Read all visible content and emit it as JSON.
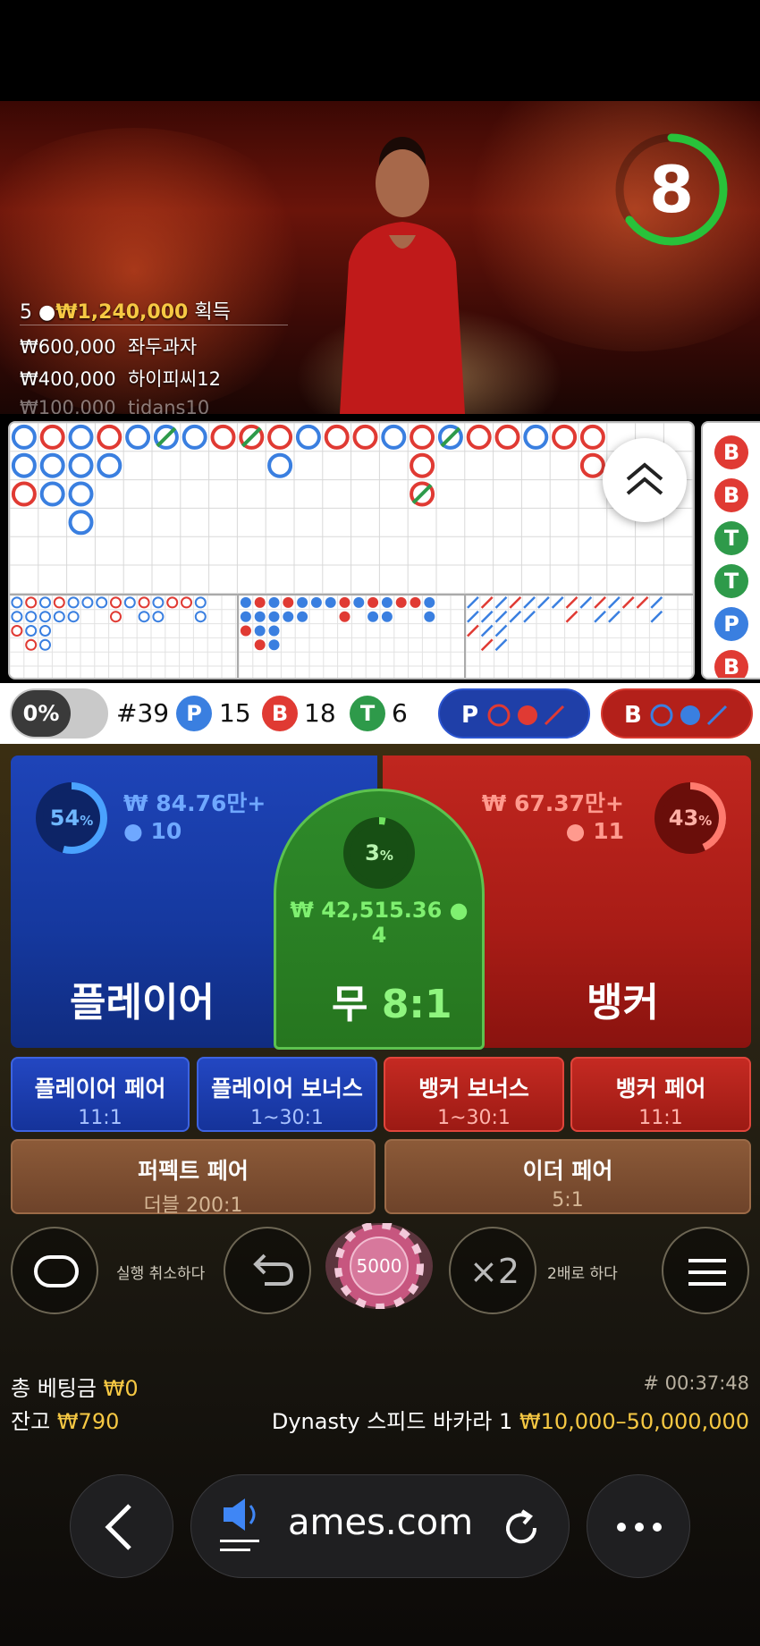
{
  "timer": {
    "value": "8",
    "progress": 0.65
  },
  "winners": {
    "title_count": "5",
    "title_amount": "₩1,240,000",
    "title_suffix": "획득",
    "rows": [
      {
        "amount": "₩600,000",
        "name": "좌두과자"
      },
      {
        "amount": "₩400,000",
        "name": "하이피씨12"
      },
      {
        "amount": "₩100,000",
        "name": "tidans10"
      }
    ]
  },
  "roadmap": {
    "big_road": [
      [
        "P",
        "P",
        "B"
      ],
      [
        "B",
        "P",
        "P"
      ],
      [
        "P",
        "P",
        "P",
        "P"
      ],
      [
        "B",
        "P"
      ],
      [
        "P"
      ],
      [
        "T"
      ],
      [
        "P"
      ],
      [
        "B"
      ],
      [
        "T"
      ],
      [
        "B",
        "P"
      ],
      [
        "P"
      ],
      [
        "B"
      ],
      [
        "B"
      ],
      [
        "P"
      ],
      [
        "B",
        "B",
        "T"
      ],
      [
        "T"
      ],
      [
        "B"
      ],
      [
        "B"
      ],
      [
        "P"
      ],
      [
        "B"
      ],
      [
        "B",
        "B"
      ]
    ],
    "predict_column": [
      "B",
      "B",
      "T",
      "T",
      "P",
      "B"
    ],
    "colors": {
      "player": "#3a7fe0",
      "banker": "#e03a33",
      "tie": "#2e9a4a"
    }
  },
  "stats": {
    "percent_toggle": "0%",
    "round": "#39",
    "player_label": "P",
    "player_count": "15",
    "banker_label": "B",
    "banker_count": "18",
    "tie_label": "T",
    "tie_count": "6",
    "ask_player": "P",
    "ask_banker": "B"
  },
  "bets": {
    "player": {
      "label": "플레이어",
      "percent": "54",
      "amount": "₩ 84.76만+",
      "users": "10",
      "share": 0.54
    },
    "banker": {
      "label": "뱅커",
      "percent": "43",
      "amount": "₩ 67.37만+",
      "users": "11",
      "share": 0.43
    },
    "tie": {
      "label": "무",
      "odds": "8:1",
      "percent": "3",
      "amount": "₩ 42,515.36",
      "users": "4",
      "share": 0.03
    },
    "side": [
      {
        "name": "플레이어 페어",
        "odds": "11:1"
      },
      {
        "name": "플레이어 보너스",
        "odds": "1~30:1"
      },
      {
        "name": "뱅커 보너스",
        "odds": "1~30:1"
      },
      {
        "name": "뱅커 페어",
        "odds": "11:1"
      },
      {
        "name": "퍼펙트 페어",
        "odds": "더블 200:1"
      },
      {
        "name": "이더 페어",
        "odds": "5:1"
      }
    ]
  },
  "controls": {
    "undo_label": "실행 취소하다",
    "chip_value": "5000",
    "double_label": "2배로 하다",
    "double_glyph": "×2"
  },
  "footer": {
    "total_bet_label": "총 베팅금",
    "total_bet": "₩0",
    "balance_label": "잔고",
    "balance": "₩790",
    "round_id": "# 00:37:48",
    "table_name": "Dynasty 스피드 바카라 1",
    "limits": "₩10,000–50,000,000"
  },
  "browser": {
    "url": "ames.com"
  }
}
